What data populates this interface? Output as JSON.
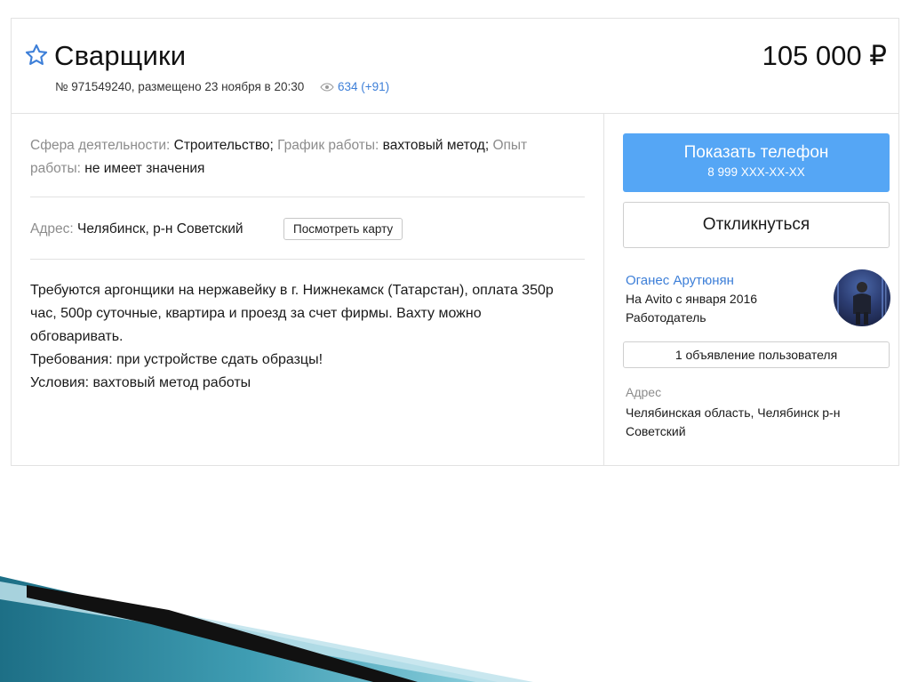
{
  "listing": {
    "title": "Сварщики",
    "number": "№ 971549240, размещено 23 ноября в 20:30",
    "views": "634 (+91)",
    "price": "105 000 ₽"
  },
  "params": {
    "sphere_label": "Сфера деятельности:",
    "sphere_value": "Строительство;",
    "schedule_label": "График работы:",
    "schedule_value": "вахтовый метод;",
    "experience_label": "Опыт работы:",
    "experience_value": "не имеет значения"
  },
  "address": {
    "label": "Адрес:",
    "value": "Челябинск, р-н Советский",
    "map_button": "Посмотреть карту"
  },
  "description": [
    "Требуются аргонщики на нержавейку в г. Нижнекамск (Татарстан), оплата 350р",
    "час, 500р суточные, квартира и проезд за счет фирмы. Вахту можно",
    "обговаривать.",
    "Требования: при устройстве сдать образцы!",
    "Условия: вахтовый метод работы"
  ],
  "sidebar": {
    "phone_button": "Показать телефон",
    "phone_number": "8 999 XXX-XX-XX",
    "respond_button": "Откликнуться",
    "seller_name": "Оганес Арутюнян",
    "seller_since": "На Avito с января 2016",
    "seller_type": "Работодатель",
    "user_ads_button": "1 объявление пользователя",
    "address_label": "Адрес",
    "address_value": "Челябинская область, Челябинск р-н Советский"
  },
  "colors": {
    "accent": "#55a6f5",
    "link": "#3d7fd8",
    "muted": "#8c8c8c"
  },
  "icons": {
    "favorite": "star-icon",
    "views": "eye-icon"
  }
}
